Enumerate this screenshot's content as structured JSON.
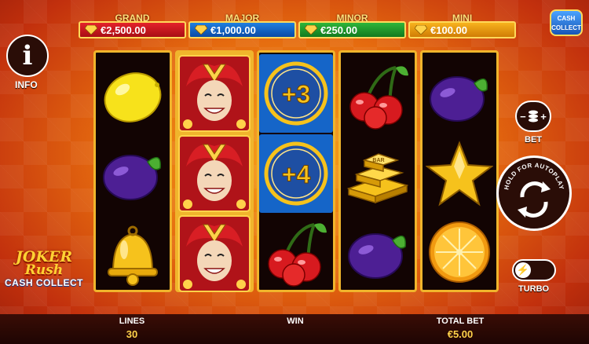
{
  "jackpots": [
    {
      "name": "GRAND",
      "value": "€2,500.00"
    },
    {
      "name": "MAJOR",
      "value": "€1,000.00"
    },
    {
      "name": "MINOR",
      "value": "€250.00"
    },
    {
      "name": "MINI",
      "value": "€100.00"
    }
  ],
  "badge": {
    "line1": "CASH",
    "line2": "COLLECT"
  },
  "info": {
    "label": "INFO"
  },
  "logo": {
    "line1": "JOKER",
    "line2": "Rush",
    "line3": "CASH COLLECT"
  },
  "reels": [
    [
      "lemon",
      "plum",
      "bell"
    ],
    [
      "joker",
      "joker",
      "joker"
    ],
    [
      "cash-coin",
      "cash-coin",
      "cherries"
    ],
    [
      "cherries",
      "gold-bars",
      "plum"
    ],
    [
      "plum",
      "star",
      "orange"
    ]
  ],
  "coins": {
    "c1": "+3",
    "c2": "+4"
  },
  "gold_bar_text": "BAR",
  "controls": {
    "bet_label": "BET",
    "bet_minus": "−",
    "bet_plus": "+",
    "autoplay_text": "HOLD FOR AUTOPLAY",
    "turbo_label": "TURBO"
  },
  "bottom": {
    "lines_label": "LINES",
    "lines_value": "30",
    "win_label": "WIN",
    "win_value": "",
    "total_bet_label": "TOTAL BET",
    "total_bet_value": "€5.00"
  },
  "colors": {
    "grand": "#e4232b",
    "major": "#1f7fe0",
    "minor": "#2fb53a",
    "mini": "#f7b31e",
    "reel_frame": "#f0b52c"
  }
}
